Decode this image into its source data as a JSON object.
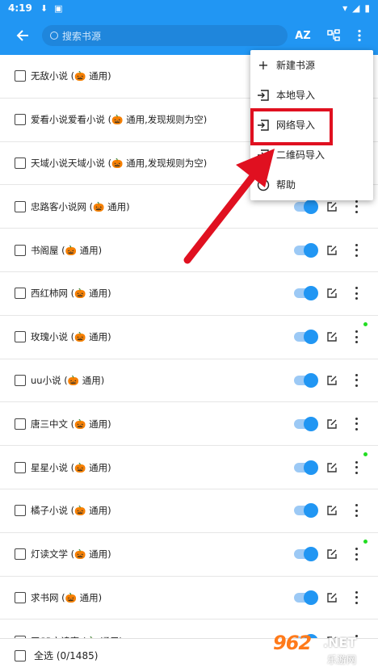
{
  "status_bar": {
    "time": "4:19"
  },
  "app_bar": {
    "search_placeholder": "搜索书源",
    "sort_label": "AZ"
  },
  "sources": [
    {
      "name": "无敌小说 (🎃 通用)",
      "switch": false,
      "dot": false
    },
    {
      "name": "爱看小说爱看小说 (🎃 通用,发现规则为空)",
      "switch": false,
      "dot": false
    },
    {
      "name": "天域小说天域小说 (🎃 通用,发现规则为空)",
      "switch": false,
      "dot": false
    },
    {
      "name": "忠路客小说网 (🎃 通用)",
      "switch": true,
      "dot": false
    },
    {
      "name": "书阁屋 (🎃 通用)",
      "switch": true,
      "dot": false
    },
    {
      "name": "西红柿网 (🎃 通用)",
      "switch": true,
      "dot": false
    },
    {
      "name": "玫瑰小说 (🎃 通用)",
      "switch": true,
      "dot": true
    },
    {
      "name": "uu小说 (🎃 通用)",
      "switch": true,
      "dot": false
    },
    {
      "name": "唐三中文 (🎃 通用)",
      "switch": true,
      "dot": false
    },
    {
      "name": "星星小说 (🎃 通用)",
      "switch": true,
      "dot": true
    },
    {
      "name": "橘子小说 (🎃 通用)",
      "switch": true,
      "dot": false
    },
    {
      "name": "灯读文学 (🎃 通用)",
      "switch": true,
      "dot": true
    },
    {
      "name": "求书网 (🎃 通用)",
      "switch": true,
      "dot": false
    },
    {
      "name": "天SP文读窝 (🎃 通用)",
      "switch": true,
      "dot": false
    }
  ],
  "menu": {
    "items": [
      {
        "label": "新建书源",
        "icon": "plus-icon"
      },
      {
        "label": "本地导入",
        "icon": "import-icon"
      },
      {
        "label": "网络导入",
        "icon": "import-icon"
      },
      {
        "label": "二维码导入",
        "icon": "import-icon"
      },
      {
        "label": "帮助",
        "icon": "help-icon"
      }
    ]
  },
  "bottom_bar": {
    "select_all": "全选 (0/1485)"
  },
  "watermark": {
    "logo": "962",
    "net": ".NET",
    "site": "乐游网"
  },
  "colors": {
    "primary": "#2196f3",
    "highlight": "#e01020",
    "indicator": "#22dd22"
  }
}
